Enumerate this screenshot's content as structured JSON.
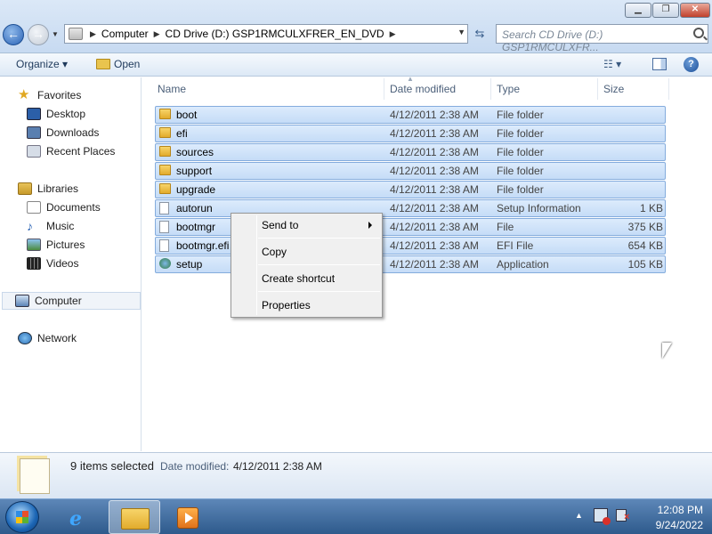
{
  "window": {
    "minimize_icon": "minimize-icon",
    "maximize_icon": "maximize-icon",
    "close_icon": "close-icon"
  },
  "address_bar": {
    "breadcrumbs": [
      "Computer",
      "CD Drive (D:) GSP1RMCULXFRER_EN_DVD"
    ],
    "search_placeholder": "Search CD Drive (D:) GSP1RMCULXFR..."
  },
  "toolbar": {
    "organize_label": "Organize ▾",
    "open_label": "Open",
    "views_label": "☷ ▾",
    "help_label": "?"
  },
  "nav_pane": {
    "favorites": "Favorites",
    "desktop": "Desktop",
    "downloads": "Downloads",
    "recent_places": "Recent Places",
    "libraries": "Libraries",
    "documents": "Documents",
    "music": "Music",
    "pictures": "Pictures",
    "videos": "Videos",
    "computer": "Computer",
    "network": "Network"
  },
  "columns": {
    "name": "Name",
    "date_modified": "Date modified",
    "type": "Type",
    "size": "Size"
  },
  "files": [
    {
      "name": "boot",
      "date": "4/12/2011 2:38 AM",
      "type": "File folder",
      "size": "",
      "icon": "folder-icon"
    },
    {
      "name": "efi",
      "date": "4/12/2011 2:38 AM",
      "type": "File folder",
      "size": "",
      "icon": "folder-icon"
    },
    {
      "name": "sources",
      "date": "4/12/2011 2:38 AM",
      "type": "File folder",
      "size": "",
      "icon": "folder-icon"
    },
    {
      "name": "support",
      "date": "4/12/2011 2:38 AM",
      "type": "File folder",
      "size": "",
      "icon": "folder-icon"
    },
    {
      "name": "upgrade",
      "date": "4/12/2011 2:38 AM",
      "type": "File folder",
      "size": "",
      "icon": "folder-icon"
    },
    {
      "name": "autorun",
      "date": "4/12/2011 2:38 AM",
      "type": "Setup Information",
      "size": "1 KB",
      "icon": "settings-file-icon"
    },
    {
      "name": "bootmgr",
      "date": "4/12/2011 2:38 AM",
      "type": "File",
      "size": "375 KB",
      "icon": "file-icon"
    },
    {
      "name": "bootmgr.efi",
      "date": "4/12/2011 2:38 AM",
      "type": "EFI File",
      "size": "654 KB",
      "icon": "file-icon"
    },
    {
      "name": "setup",
      "date": "4/12/2011 2:38 AM",
      "type": "Application",
      "size": "105 KB",
      "icon": "setup-app-icon"
    }
  ],
  "context_menu": {
    "send_to": "Send to",
    "copy": "Copy",
    "create_shortcut": "Create shortcut",
    "properties": "Properties"
  },
  "details": {
    "selection": "9 items selected",
    "date_label": "Date modified:",
    "date_value": "4/12/2011 2:38 AM"
  },
  "taskbar": {
    "time": "12:08 PM",
    "date": "9/24/2022"
  }
}
